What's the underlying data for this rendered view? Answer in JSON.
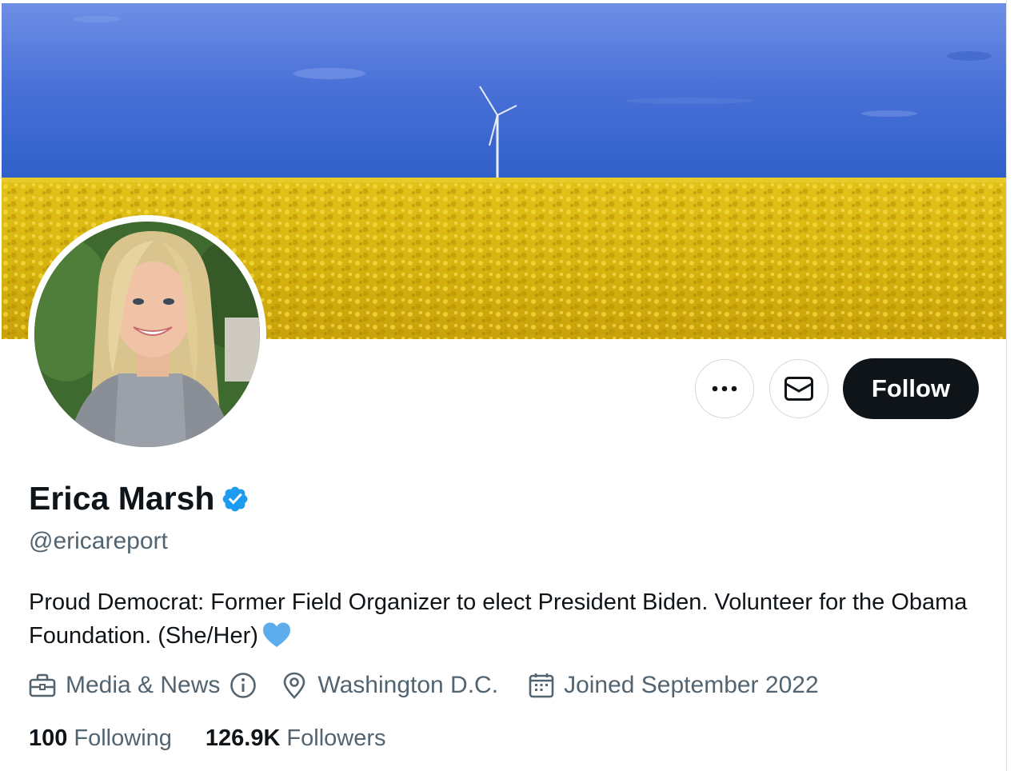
{
  "profile": {
    "name": "Erica Marsh",
    "handle": "@ericareport",
    "bio": "Proud Democrat: Former Field Organizer to elect President Biden. Volunteer for the Obama Foundation. (She/Her)",
    "category": "Media & News",
    "location": "Washington D.C.",
    "joined": "Joined September 2022",
    "following_count": "100",
    "following_label": "Following",
    "followers_count": "126.9K",
    "followers_label": "Followers"
  },
  "actions": {
    "follow_label": "Follow",
    "more_icon": "more-dots-icon",
    "message_icon": "envelope-icon"
  },
  "icons": {
    "verified": "verified-badge-icon",
    "heart": "blue-heart-icon",
    "category": "briefcase-icon",
    "info": "info-icon",
    "location": "location-pin-icon",
    "calendar": "calendar-icon"
  },
  "colors": {
    "primary_text": "#0f1419",
    "secondary_text": "#536471",
    "verified_blue": "#1d9bf0",
    "follow_bg": "#0f1419",
    "border": "#cfd9de"
  }
}
